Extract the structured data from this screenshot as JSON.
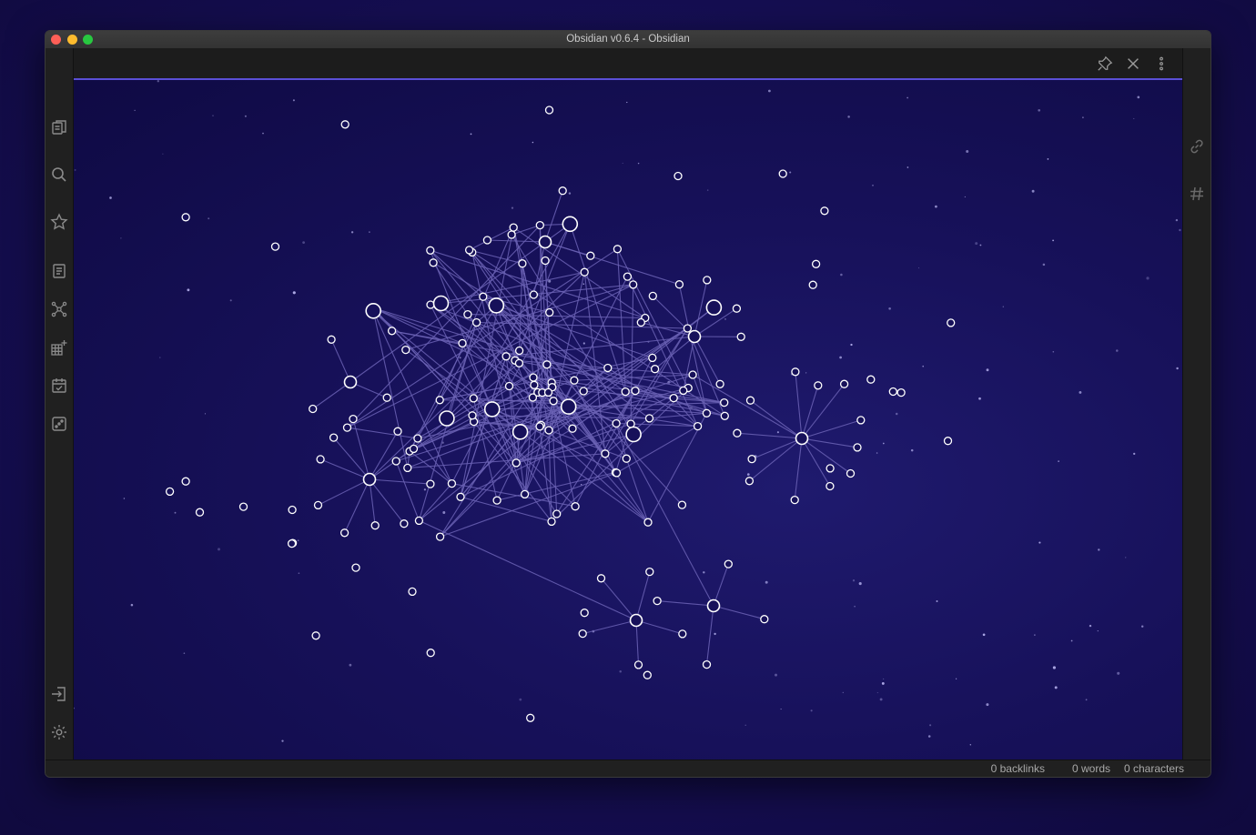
{
  "window": {
    "title": "Obsidian v0.6.4 - Obsidian"
  },
  "ribbon_left": [
    {
      "name": "files-icon"
    },
    {
      "name": "search-icon"
    },
    {
      "name": "star-icon"
    },
    {
      "name": "document-icon"
    },
    {
      "name": "graph-icon"
    },
    {
      "name": "grid-plus-icon"
    },
    {
      "name": "calendar-icon"
    },
    {
      "name": "dice-icon"
    },
    {
      "name": "open-vault-icon"
    },
    {
      "name": "settings-icon"
    }
  ],
  "ribbon_right": [
    {
      "name": "link-icon"
    },
    {
      "name": "tag-icon"
    }
  ],
  "view_header": {
    "actions": [
      "pin-icon",
      "close-icon",
      "more-options-icon"
    ]
  },
  "status_bar": {
    "backlinks": "0 backlinks",
    "words": "0 words",
    "characters": "0 characters"
  },
  "colors": {
    "accent": "#5a4fd6",
    "node_stroke": "#ffffff",
    "edge": "#6b62b5",
    "background": "#17115a"
  }
}
